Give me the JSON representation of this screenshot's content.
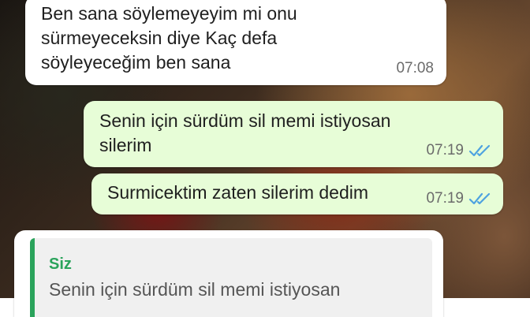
{
  "messages": [
    {
      "direction": "incoming",
      "text_lines": [
        "Ben sana söylemeyeyim mi onu",
        "sürmeyeceksin diye Kaç defa",
        "söyleyeceğim ben sana"
      ],
      "time": "07:08"
    },
    {
      "direction": "outgoing",
      "text_lines": [
        "Senin için sürdüm sil memi istiyosan",
        "silerim"
      ],
      "time": "07:19",
      "status_icon": "double-check-read-icon"
    },
    {
      "direction": "outgoing",
      "text_lines": [
        "Surmicektim zaten silerim dedim"
      ],
      "time": "07:19",
      "status_icon": "double-check-read-icon"
    },
    {
      "direction": "incoming",
      "quote": {
        "sender": "Siz",
        "text": "Senin için sürdüm sil memi istiyosan"
      }
    }
  ],
  "colors": {
    "incoming_bubble": "#ffffff",
    "outgoing_bubble": "#e7fdd7",
    "read_ticks": "#4fa3e0",
    "quote_accent": "#2aa35b"
  }
}
